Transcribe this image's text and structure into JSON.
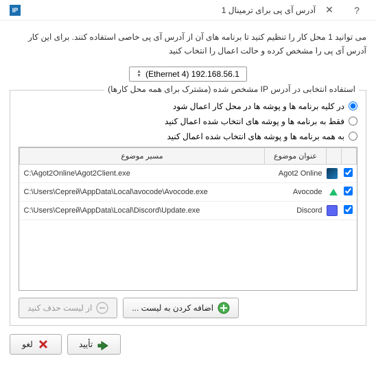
{
  "titlebar": {
    "icon_text": "IP",
    "title": "آدرس آی پی برای ترمینال 1"
  },
  "description": "می توانید 1 محل کار را تنظیم کنید تا برنامه های آن از آدرس آی پی  خاصی استفاده کنند. برای این کار آدرس آی پی را مشخص کرده و حالت اعمال را انتخاب کنید",
  "dropdown": {
    "value": "(Ethernet 4) 192.168.56.1"
  },
  "fieldset": {
    "legend": "استفاده انتخابی در آدرس IP مشخص شده (مشترک برای همه محل کارها)",
    "radios": {
      "r0": "در کلیه برنامه ها و پوشه ها در محل کار اعمال شود",
      "r1": "فقط به برنامه ها و پوشه های انتخاب شده اعمال کنید",
      "r2": "به همه برنامه ها و پوشه های انتخاب شده اعمال کنید"
    }
  },
  "table": {
    "headers": {
      "subject": "عنوان موضوع",
      "path": "مسیر موضوع"
    },
    "rows": [
      {
        "checked": true,
        "icon": "agot",
        "subject": "Agot2 Online",
        "path": "C:\\Agot2Online\\Agot2Client.exe"
      },
      {
        "checked": true,
        "icon": "avo",
        "subject": "Avocode",
        "path": "C:\\Users\\Сергей\\AppData\\Local\\avocode\\Avocode.exe"
      },
      {
        "checked": true,
        "icon": "discord",
        "subject": "Discord",
        "path": "C:\\Users\\Сергей\\AppData\\Local\\Discord\\Update.exe"
      }
    ]
  },
  "buttons": {
    "add": "اضافه کردن به لیست ...",
    "remove": "از لیست حذف کنید",
    "ok": "تأیید",
    "cancel": "لغو"
  }
}
